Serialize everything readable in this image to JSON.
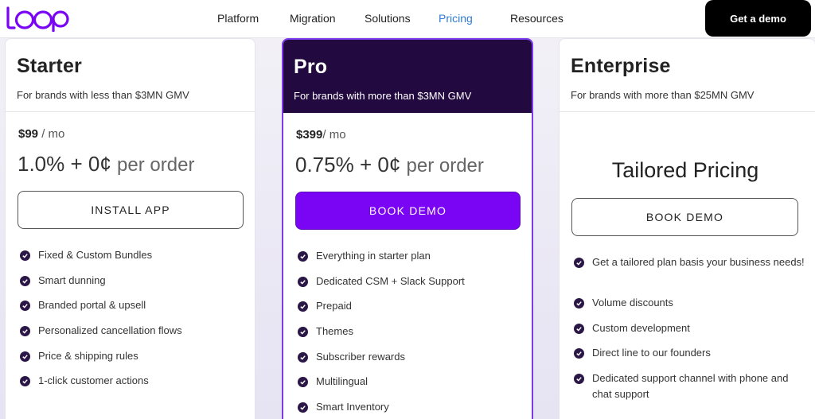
{
  "header": {
    "logo_text": "Loop",
    "nav": [
      "Platform",
      "Migration",
      "Solutions",
      "Pricing",
      "Resources"
    ],
    "active_nav": "Pricing",
    "cta": "Get a demo"
  },
  "plans": {
    "starter": {
      "name": "Starter",
      "subtitle": "For brands with less than $3MN GMV",
      "price_amount": "$99",
      "price_unit": " / mo",
      "rate_main": "1.0% + 0¢",
      "rate_suffix": "per order",
      "cta": "INSTALL APP",
      "features": [
        "Fixed & Custom Bundles",
        "Smart dunning",
        "Branded portal & upsell",
        "Personalized cancellation flows",
        "Price & shipping rules",
        "1-click customer actions"
      ]
    },
    "pro": {
      "name": "Pro",
      "subtitle": "For brands with more than $3MN GMV",
      "price_amount": "$399",
      "price_unit": "/ mo",
      "rate_main": "0.75% + 0¢",
      "rate_suffix": "per order",
      "cta": "BOOK DEMO",
      "features": [
        "Everything in starter plan",
        "Dedicated CSM + Slack Support",
        "Prepaid",
        "Themes",
        "Subscriber rewards",
        "Multilingual",
        "Smart Inventory"
      ]
    },
    "enterprise": {
      "name": "Enterprise",
      "subtitle": "For brands with more than $25MN GMV",
      "tailored": "Tailored Pricing",
      "cta": "BOOK DEMO",
      "features": [
        "Get a tailored plan basis your business needs!",
        "Volume discounts",
        "Custom development",
        "Direct line to our founders",
        "Dedicated support channel with phone and chat support"
      ]
    }
  },
  "colors": {
    "brand_purple": "#7a05f4",
    "pro_header": "#22093f",
    "active_nav": "#2f7bd6",
    "check": "#2b1747"
  }
}
